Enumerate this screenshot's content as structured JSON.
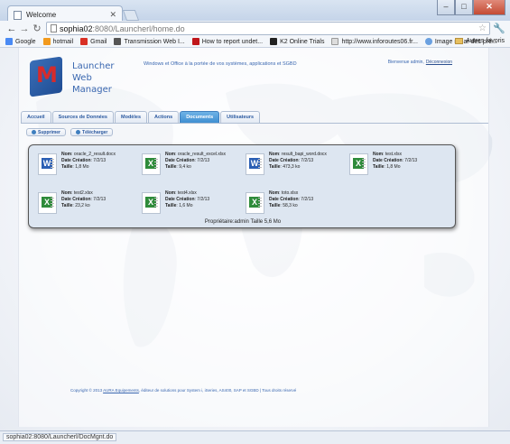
{
  "browser": {
    "tab_title": "Welcome",
    "url_host": "sophia02",
    "url_path": ":8080/Launcherl/home.do",
    "status_text": "sophia02:8080/Launcherl/DocMgnt.do"
  },
  "bookmarks": {
    "items": [
      "Google",
      "hotmail",
      "Gmail",
      "Transmission Web I...",
      "How to report undet...",
      "K2 Online Trials",
      "http://www.inforoutes06.fr...",
      "Image radar des pré..."
    ],
    "folder": "Autres favoris"
  },
  "header": {
    "logo_letter": "M",
    "logo_line1": "Launcher",
    "logo_line2": "Web",
    "logo_line3": "Manager",
    "tagline": "Windows et Office à la portée de vos systèmes, applications et SGBD",
    "welcome": "Bienvenue admin,",
    "logout": "Déconnexion"
  },
  "tabs": [
    "Accueil",
    "Sources de Données",
    "Modèles",
    "Actions",
    "Documents",
    "Utilisateurs"
  ],
  "active_tab": "Documents",
  "actions": {
    "delete": "Supprimer",
    "download": "Télécharger"
  },
  "labels": {
    "name": "Nom",
    "created": "Date Création",
    "size": "Taille"
  },
  "files": [
    {
      "name": "oracle_2_result.docx",
      "type": "docx",
      "date": "7/2/13",
      "size": "1,8 Mo"
    },
    {
      "name": "oracle_result_excel.xlsx",
      "type": "xlsx",
      "date": "7/2/13",
      "size": "9,4 ko"
    },
    {
      "name": "result_bapi_word.docx",
      "type": "docx",
      "date": "7/2/13",
      "size": "473,3 ko"
    },
    {
      "name": "test.xlsx",
      "type": "xlsx",
      "date": "7/2/13",
      "size": "1,8 Mo"
    },
    {
      "name": "test2.xlsx",
      "type": "xlsx",
      "date": "7/2/13",
      "size": "23,2 ko"
    },
    {
      "name": "test4.xlsx",
      "type": "xlsx",
      "date": "7/2/13",
      "size": "1,6 Mo"
    },
    {
      "name": "toto.xlsx",
      "type": "xlsx",
      "date": "7/2/13",
      "size": "58,3 ko"
    }
  ],
  "owner_line": "Propriétaire:admin Taille 5,6 Mo",
  "footer": {
    "prefix": "Copyright © 2013",
    "company": "AURA Equipements",
    "suffix": ", éditeur de solutions pour System i, iSeries, AS400, SAP et SGBD | Tous droits réservé"
  }
}
